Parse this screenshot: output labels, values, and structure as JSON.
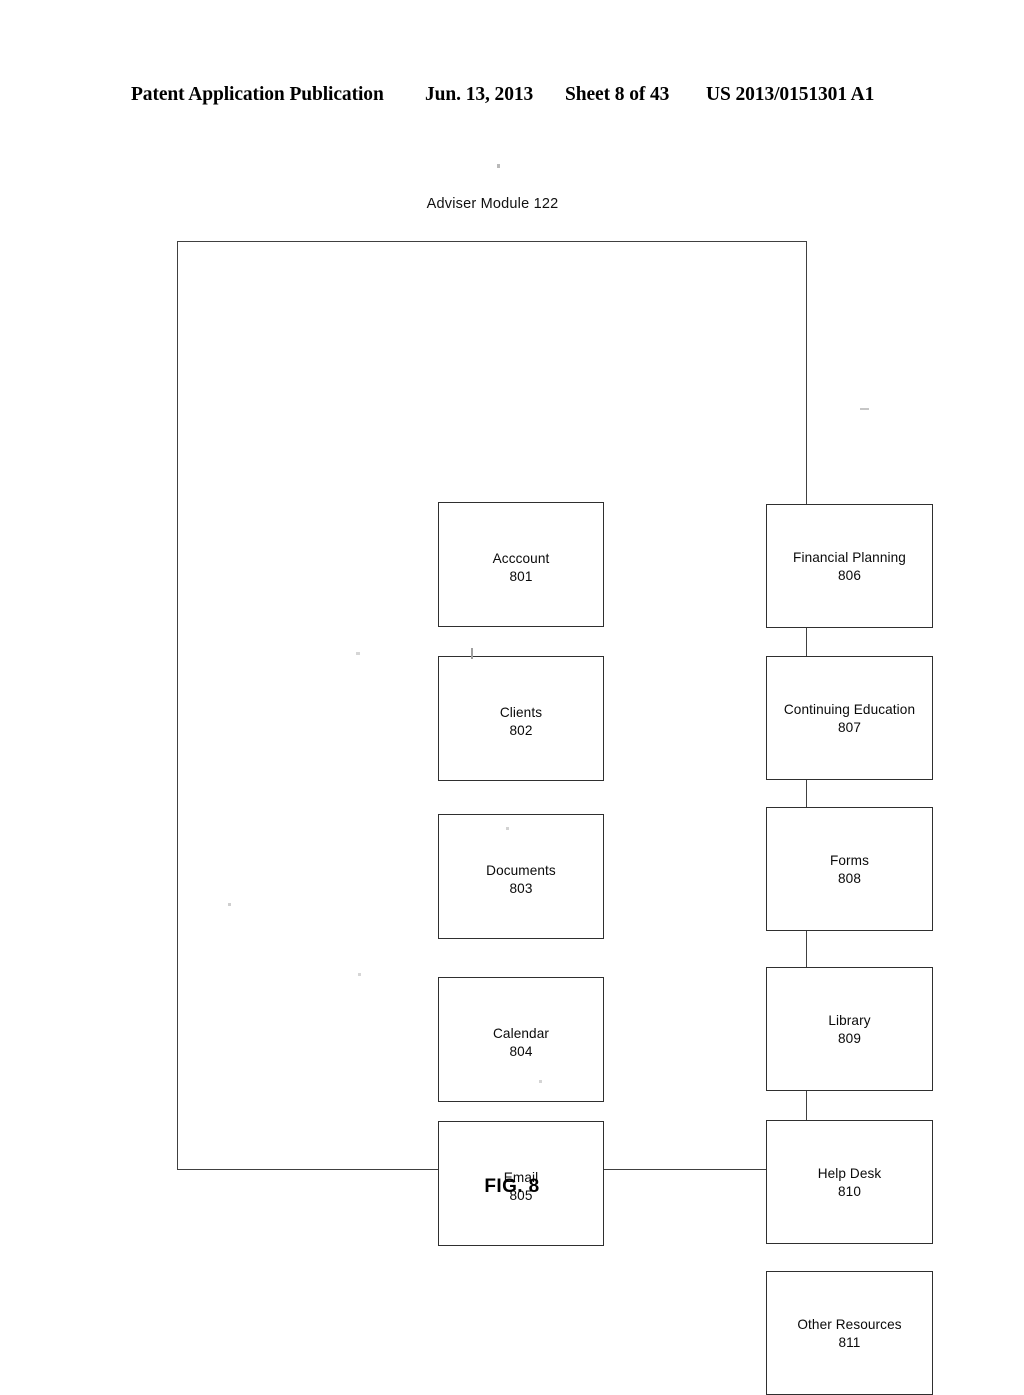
{
  "header": {
    "publication": "Patent Application Publication",
    "date": "Jun. 13, 2013",
    "sheet": "Sheet 8 of 43",
    "document_number": "US 2013/0151301 A1"
  },
  "figure": {
    "module_title": "Adviser Module 122",
    "figure_number": "FIG. 8"
  },
  "diagram": {
    "left_column": [
      {
        "label": "Acccount",
        "ref": "801"
      },
      {
        "label": "Clients",
        "ref": "802"
      },
      {
        "label": "Documents",
        "ref": "803"
      },
      {
        "label": "Calendar",
        "ref": "804"
      },
      {
        "label": "Email",
        "ref": "805"
      }
    ],
    "right_column": [
      {
        "label": "Financial Planning",
        "ref": "806"
      },
      {
        "label": "Continuing Education",
        "ref": "807"
      },
      {
        "label": "Forms",
        "ref": "808"
      },
      {
        "label": "Library",
        "ref": "809"
      },
      {
        "label": "Help Desk",
        "ref": "810"
      },
      {
        "label": "Other Resources",
        "ref": "811"
      }
    ]
  }
}
